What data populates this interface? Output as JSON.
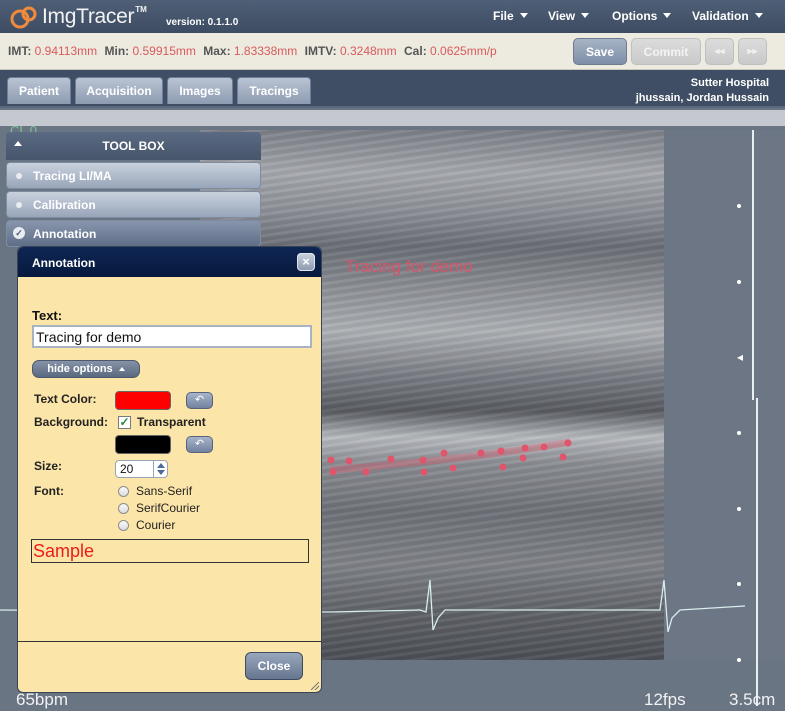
{
  "app": {
    "logo_text": "ImgTracer",
    "logo_tm": "TM",
    "version": "version: 0.1.1.0"
  },
  "menu": {
    "items": [
      {
        "label": "File"
      },
      {
        "label": "View"
      },
      {
        "label": "Options"
      },
      {
        "label": "Validation"
      }
    ]
  },
  "stats": {
    "imt_label": "IMT:",
    "imt_value": "0.94113mm",
    "min_label": "Min:",
    "min_value": "0.59915mm",
    "max_label": "Max:",
    "max_value": "1.83338mm",
    "imtv_label": "IMTV:",
    "imtv_value": "0.3248mm",
    "cal_label": "Cal:",
    "cal_value": "0.0625mm/p"
  },
  "toolbar": {
    "save_label": "Save",
    "commit_label": "Commit",
    "prev_label": "◂◂",
    "next_label": "▸▸"
  },
  "tabs": [
    {
      "label": "Patient"
    },
    {
      "label": "Acquisition"
    },
    {
      "label": "Images"
    },
    {
      "label": "Tracings"
    }
  ],
  "header_info": {
    "hospital": "Sutter Hospital",
    "user": "jhussain, Jordan Hussain"
  },
  "toolbox": {
    "title": "TOOL BOX",
    "items": [
      {
        "label": "Tracing LI/MA",
        "state": "inactive"
      },
      {
        "label": "Calibration",
        "state": "inactive"
      },
      {
        "label": "Annotation",
        "state": "active"
      }
    ]
  },
  "viewer": {
    "overlay_text": "Tracing for demo",
    "heart_rate": "65bpm",
    "fps": "12fps",
    "depth": "3.5cm",
    "corner_ghost": "CL 0",
    "trace_color": "#e0556b"
  },
  "annotation_dialog": {
    "title": "Annotation",
    "close_icon": "×",
    "text_label": "Text:",
    "text_value": "Tracing for demo",
    "options_button": "hide options",
    "text_color_label": "Text Color:",
    "text_color": "#ff0000",
    "background_label": "Background:",
    "transparent_label": "Transparent",
    "transparent_checked": true,
    "background_color": "#000000",
    "undo_icon": "↶",
    "size_label": "Size:",
    "size_value": "20",
    "font_label": "Font:",
    "font_options": [
      {
        "label": "Sans-Serif"
      },
      {
        "label": "SerifCourier"
      },
      {
        "label": "Courier"
      }
    ],
    "sample_text": "Sample",
    "close_button": "Close"
  }
}
